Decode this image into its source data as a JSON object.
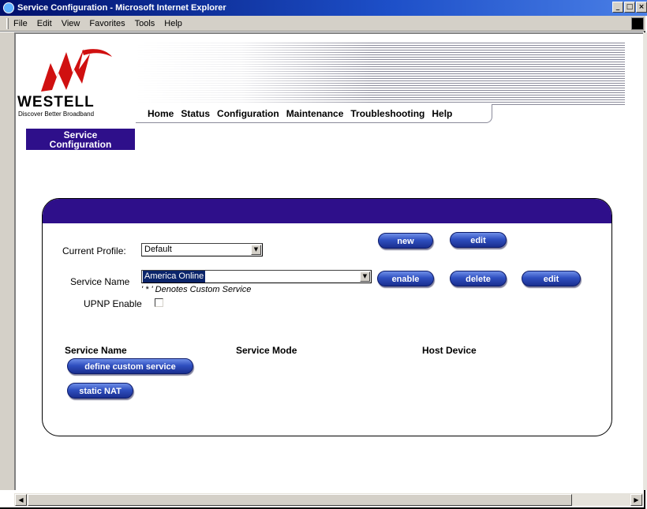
{
  "window": {
    "title": "Service Configuration - Microsoft Internet Explorer",
    "buttons": {
      "minimize": "_",
      "maximize": "□",
      "close": "×"
    }
  },
  "menubar": {
    "items": [
      "File",
      "Edit",
      "View",
      "Favorites",
      "Tools",
      "Help"
    ]
  },
  "logo": {
    "brand": "WESTELL",
    "tagline": "Discover Better Broadband"
  },
  "nav": {
    "items": [
      "Home",
      "Status",
      "Configuration",
      "Maintenance",
      "Troubleshooting",
      "Help"
    ]
  },
  "section_tab": {
    "line1": "Service",
    "line2": "Configuration"
  },
  "form": {
    "current_profile_label": "Current Profile:",
    "current_profile_value": "Default",
    "service_name_label": "Service Name",
    "service_name_value": "America Online",
    "custom_note": "' * ' Denotes Custom Service",
    "upnp_label": "UPNP Enable",
    "upnp_checked": false,
    "buttons": {
      "new": "new",
      "edit_profile": "edit",
      "enable": "enable",
      "delete": "delete",
      "edit_service": "edit"
    }
  },
  "table": {
    "col_service_name": "Service Name",
    "col_service_mode": "Service Mode",
    "col_host_device": "Host Device",
    "define_custom_service": "define custom service",
    "static_nat": "static NAT"
  },
  "colors": {
    "accent": "#2e0f8a",
    "button": "#2f4fc0",
    "titlebar": "#00106b"
  }
}
